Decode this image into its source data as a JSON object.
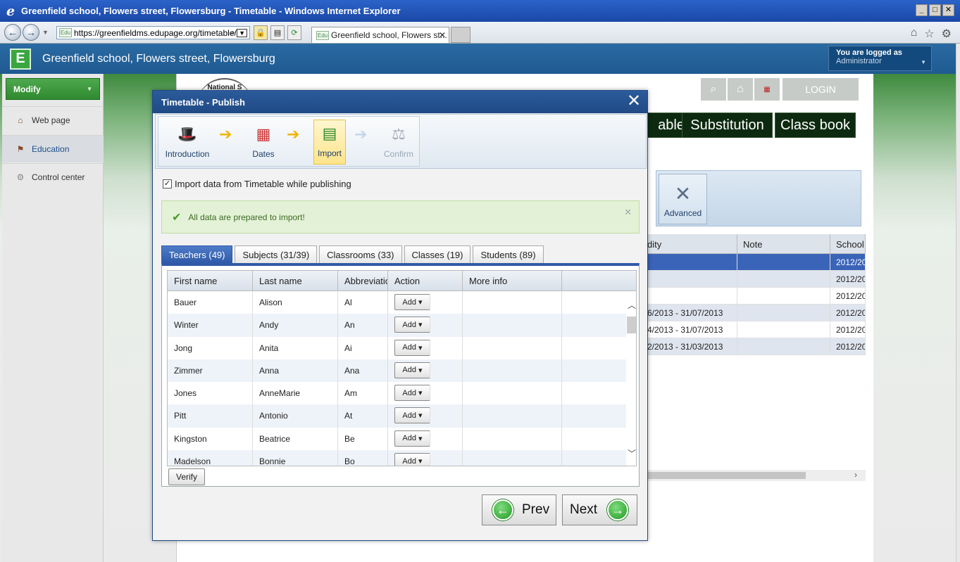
{
  "browser": {
    "window_title": "Greenfield school, Flowers street, Flowersburg - Timetable - Windows Internet Explorer",
    "url": "https://greenfieldms.edupage.org/timetable/",
    "tab_title": "Greenfield school, Flowers st...",
    "favicon_text": "Edu"
  },
  "site": {
    "logo_letter": "E",
    "title": "Greenfield school, Flowers street, Flowersburg",
    "logged_label": "You are logged as",
    "logged_user": "Administrator",
    "login_label": "LOGIN",
    "seal_text": "National S",
    "nav": [
      "able",
      "Substitution",
      "Class book"
    ]
  },
  "sidebar": {
    "modify_label": "Modify",
    "items": [
      {
        "label": "Web page",
        "icon": "house-icon"
      },
      {
        "label": "Education",
        "icon": "flag-icon"
      },
      {
        "label": "Control center",
        "icon": "gear-icon"
      }
    ]
  },
  "background_panel": {
    "advanced_label": "Advanced",
    "columns": [
      "dity",
      "Note",
      "School"
    ],
    "rows": [
      {
        "validity": "",
        "note": "",
        "school": "2012/20"
      },
      {
        "validity": "",
        "note": "",
        "school": "2012/20"
      },
      {
        "validity": "",
        "note": "",
        "school": "2012/20"
      },
      {
        "validity": "6/2013 - 31/07/2013",
        "note": "",
        "school": "2012/20"
      },
      {
        "validity": "4/2013 - 31/07/2013",
        "note": "",
        "school": "2012/20"
      },
      {
        "validity": "2/2013 - 31/03/2013",
        "note": "",
        "school": "2012/20"
      }
    ]
  },
  "dialog": {
    "title": "Timetable - Publish",
    "steps": [
      {
        "label": "Introduction",
        "state": "done"
      },
      {
        "label": "Dates",
        "state": "done"
      },
      {
        "label": "Import",
        "state": "current"
      },
      {
        "label": "Confirm",
        "state": "disabled"
      }
    ],
    "import_checkbox_label": "Import data from Timetable while publishing",
    "import_checked": true,
    "alert_text": "All data are prepared to import!",
    "tabs": [
      "Teachers (49)",
      "Subjects (31/39)",
      "Classrooms (33)",
      "Classes (19)",
      "Students (89)"
    ],
    "grid": {
      "columns": [
        "First name",
        "Last name",
        "Abbreviation",
        "Action",
        "More info"
      ],
      "rows": [
        {
          "first": "Bauer",
          "last": "Alison",
          "abbr": "Al",
          "action": "Add",
          "info": ""
        },
        {
          "first": "Winter",
          "last": "Andy",
          "abbr": "An",
          "action": "Add",
          "info": ""
        },
        {
          "first": "Jong",
          "last": "Anita",
          "abbr": "Ai",
          "action": "Add",
          "info": ""
        },
        {
          "first": "Zimmer",
          "last": "Anna",
          "abbr": "Ana",
          "action": "Add",
          "info": ""
        },
        {
          "first": "Jones",
          "last": "AnneMarie",
          "abbr": "Am",
          "action": "Add",
          "info": ""
        },
        {
          "first": "Pitt",
          "last": "Antonio",
          "abbr": "At",
          "action": "Add",
          "info": ""
        },
        {
          "first": "Kingston",
          "last": "Beatrice",
          "abbr": "Be",
          "action": "Add",
          "info": ""
        },
        {
          "first": "Madelson",
          "last": "Bonnie",
          "abbr": "Bo",
          "action": "Add",
          "info": ""
        }
      ]
    },
    "verify_label": "Verify",
    "prev_label": "Prev",
    "next_label": "Next"
  },
  "colors": {
    "accent": "#2e5aa8",
    "success": "#e3f2d7",
    "header": "#1f5a91"
  }
}
